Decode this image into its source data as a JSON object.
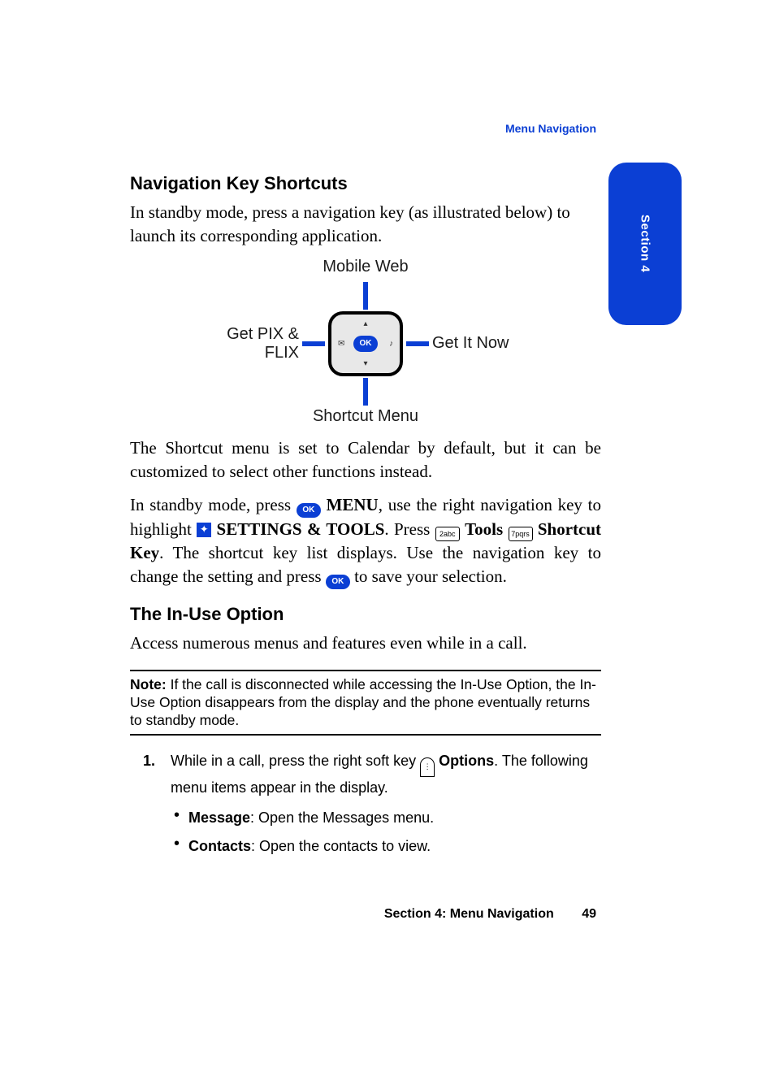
{
  "running_header": "Menu Navigation",
  "section_tab": "Section 4",
  "headings": {
    "nav_shortcuts": "Navigation Key Shortcuts",
    "in_use": "The In-Use Option"
  },
  "paragraphs": {
    "intro": "In standby mode, press a navigation key (as illustrated below) to launch its corresponding application.",
    "shortcut_default": "The Shortcut menu is set to Calendar by default, but it can be customized to select other functions instead.",
    "instructions_pre": "In standby mode, press ",
    "instructions_menu_bold": "MENU",
    "instructions_mid1": ", use the right navigation key to highlight ",
    "instructions_settings_bold": "SETTINGS & TOOLS",
    "instructions_mid2": ". Press ",
    "instructions_tools_bold": "Tools",
    "instructions_shortcut_bold": "Shortcut Key",
    "instructions_end": ". The shortcut key list displays. Use the navigation key to change the setting and press ",
    "instructions_save": " to save your selection.",
    "in_use_intro": "Access numerous menus and features even while in a call."
  },
  "diagram": {
    "top": "Mobile Web",
    "left": "Get PIX & FLIX",
    "right": "Get It Now",
    "bottom": "Shortcut Menu",
    "ok": "OK"
  },
  "keys": {
    "ok": "OK",
    "two": "2abc",
    "seven": "7pqrs"
  },
  "note": {
    "label": "Note:",
    "text": " If the call is disconnected while accessing the In-Use Option, the In-Use Option disappears from the display and the phone eventually returns to standby mode."
  },
  "step1": {
    "num": "1.",
    "pre": "While in a call, press the right soft key ",
    "options_bold": "Options",
    "post": ". The following menu items appear in the display."
  },
  "bullets": {
    "message_bold": "Message",
    "message_text": ": Open the Messages menu.",
    "contacts_bold": "Contacts",
    "contacts_text": ": Open the contacts to view."
  },
  "footer": {
    "title": "Section 4: Menu Navigation",
    "page": "49"
  }
}
